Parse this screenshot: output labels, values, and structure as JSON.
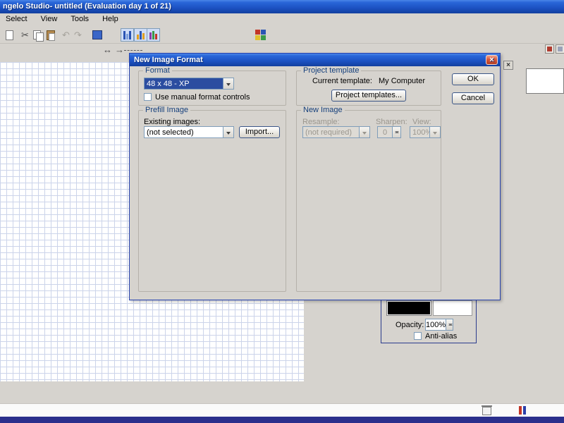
{
  "window": {
    "title": "ngelo Studio- untitled  (Evaluation day 1 of 21)"
  },
  "menu": {
    "items": [
      "Select",
      "View",
      "Tools",
      "Help"
    ]
  },
  "icons": {
    "cut": "✂",
    "undo": "↶",
    "redo": "↷",
    "close": "×",
    "left_right_arrow": "↔",
    "right_arrow": "→"
  },
  "dialog": {
    "title": "New Image Format",
    "format": {
      "label": "Format",
      "value": "48 x 48 - XP",
      "manual_checkbox": "Use manual format controls"
    },
    "project": {
      "label": "Project template",
      "current_label": "Current template:",
      "current_value": "My Computer",
      "templates_button": "Project templates..."
    },
    "prefill": {
      "label": "Prefill Image",
      "existing_label": "Existing images:",
      "value": "(not selected)",
      "import_button": "Import..."
    },
    "new_image": {
      "label": "New Image",
      "resample_label": "Resample:",
      "resample_value": "(not required)",
      "sharpen_label": "Sharpen:",
      "sharpen_value": "0",
      "view_label": "View:",
      "view_value": "100%"
    },
    "ok_button": "OK",
    "cancel_button": "Cancel"
  },
  "color_panel": {
    "opacity_label": "Opacity:",
    "opacity_value": "100%",
    "antialias_label": "Anti-alias"
  },
  "colors": {
    "titlebar_top": "#4a86e8",
    "titlebar_bottom": "#123f9f",
    "selection": "#2b4da0",
    "grid_line": "#ccd4ea",
    "dialog_bg": "#d6d3ce",
    "bottom_bar": "#2b2f8c",
    "close_red": "#d8573a"
  }
}
